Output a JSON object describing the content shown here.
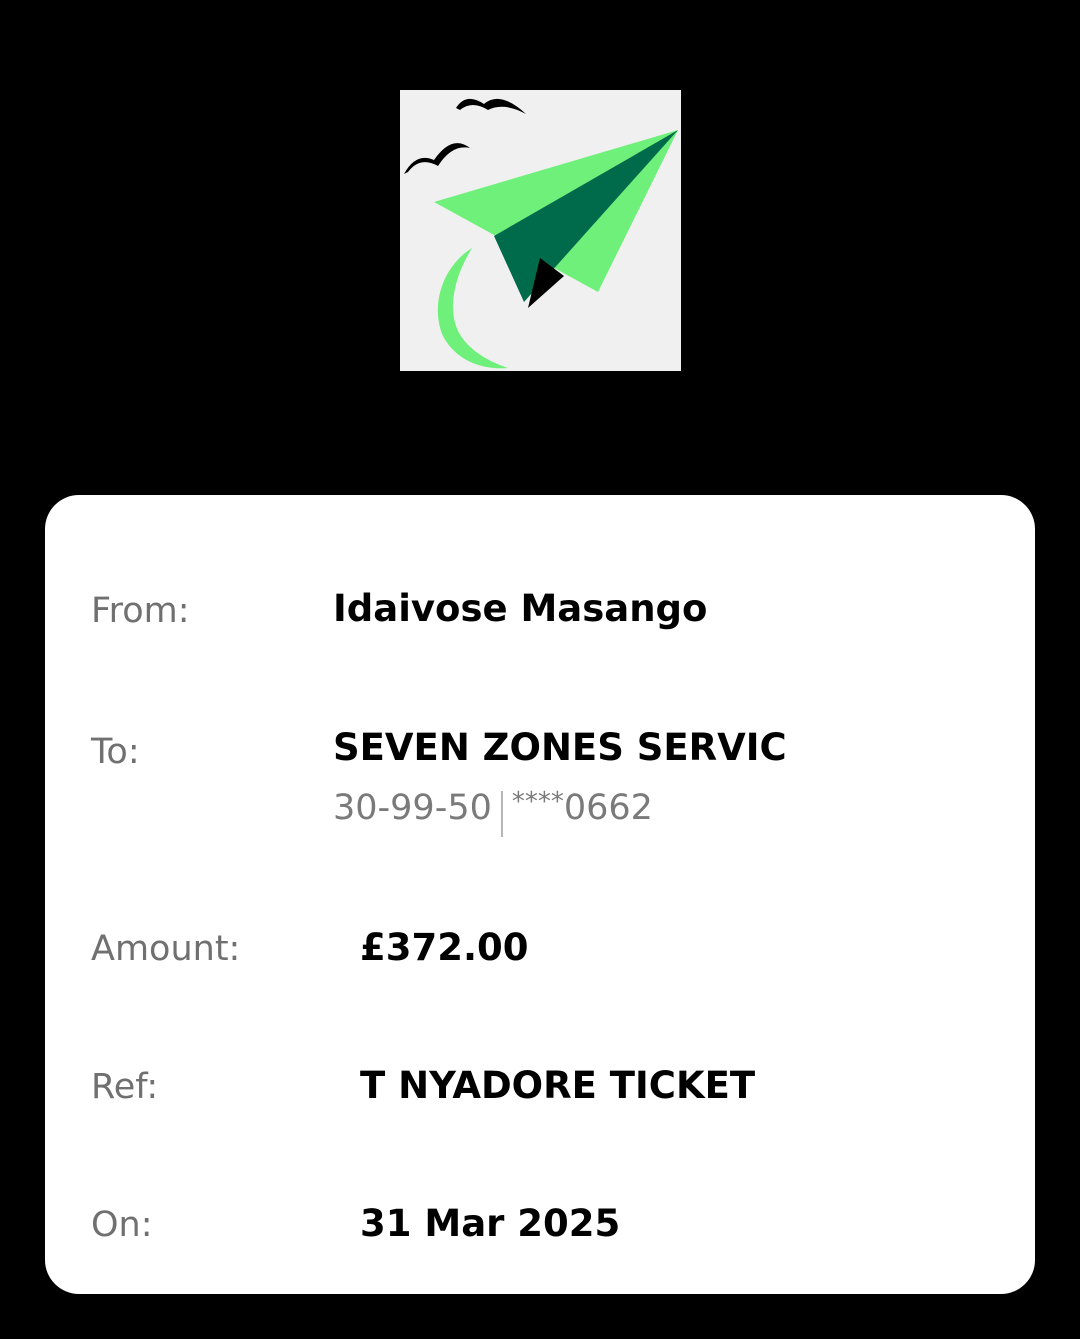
{
  "logo": {
    "icon": "paper-plane-logo",
    "background": "#f0f0f0",
    "colors": {
      "light_green": "#6ef07a",
      "dark_green": "#006b4a",
      "birds": "#000000"
    }
  },
  "details": {
    "from": {
      "label": "From:",
      "value": "Idaivose Masango"
    },
    "to": {
      "label": "To:",
      "value": "SEVEN ZONES SERVIC",
      "sort_code": "30-99-50",
      "account_mask": "****",
      "account_last4": "0662"
    },
    "amount": {
      "label": "Amount:",
      "value": "£372.00"
    },
    "ref": {
      "label": "Ref:",
      "value": "T NYADORE TICKET"
    },
    "on": {
      "label": "On:",
      "value": "31 Mar 2025"
    }
  }
}
